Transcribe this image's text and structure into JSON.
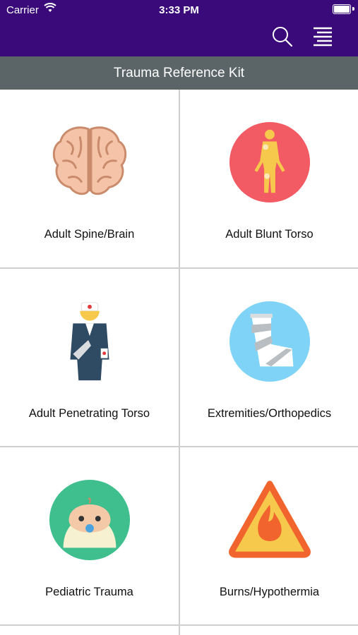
{
  "status_bar": {
    "carrier": "Carrier",
    "time": "3:33 PM"
  },
  "nav": {
    "search_icon": "search-icon",
    "menu_icon": "menu-icon"
  },
  "header": {
    "title": "Trauma Reference Kit"
  },
  "categories": [
    {
      "label": "Adult Spine/Brain",
      "icon": "brain-icon"
    },
    {
      "label": "Adult Blunt Torso",
      "icon": "body-icon"
    },
    {
      "label": "Adult Penetrating Torso",
      "icon": "patient-icon"
    },
    {
      "label": "Extremities/Orthopedics",
      "icon": "cast-icon"
    },
    {
      "label": "Pediatric Trauma",
      "icon": "baby-icon"
    },
    {
      "label": "Burns/Hypothermia",
      "icon": "fire-warning-icon"
    }
  ],
  "colors": {
    "nav_bg": "#3a0a7a",
    "title_bg": "#5b6568"
  }
}
